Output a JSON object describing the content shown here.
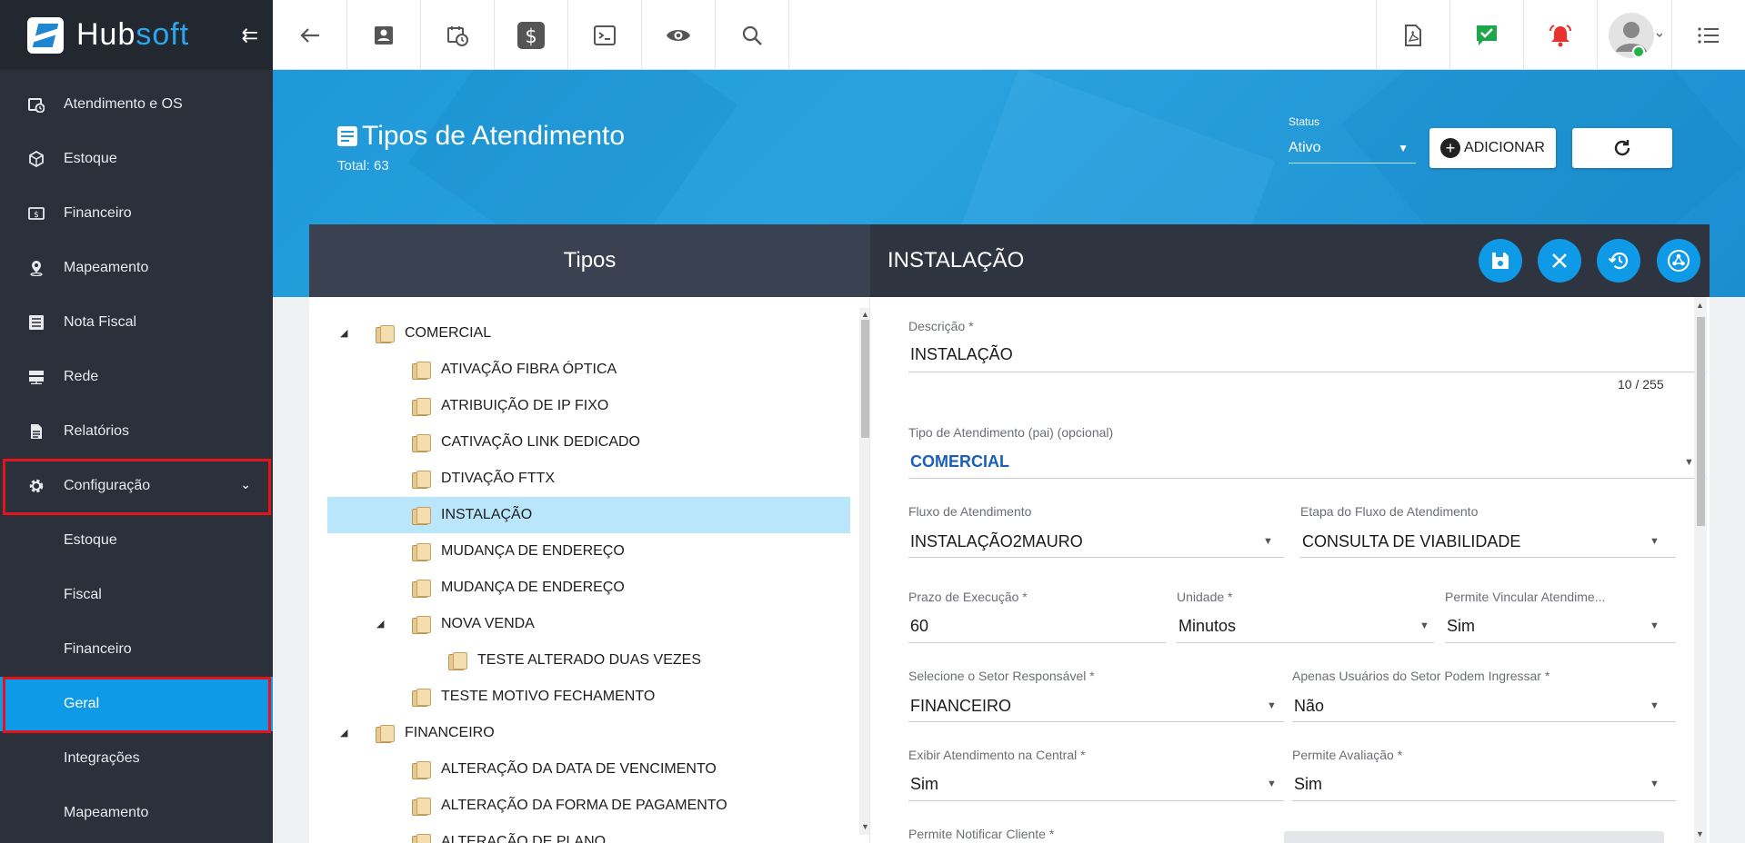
{
  "brand": {
    "name_part1": "Hub",
    "name_part2": "soft"
  },
  "sidebar": {
    "items": [
      {
        "label": "Atendimento e OS",
        "icon": "calendar-clock-icon"
      },
      {
        "label": "Estoque",
        "icon": "box-icon"
      },
      {
        "label": "Financeiro",
        "icon": "dollar-icon"
      },
      {
        "label": "Mapeamento",
        "icon": "map-pin-icon"
      },
      {
        "label": "Nota Fiscal",
        "icon": "list-icon"
      },
      {
        "label": "Rede",
        "icon": "server-icon"
      },
      {
        "label": "Relatórios",
        "icon": "document-icon"
      },
      {
        "label": "Configuração",
        "icon": "gear-icon"
      }
    ],
    "subitems": [
      {
        "label": "Estoque"
      },
      {
        "label": "Fiscal"
      },
      {
        "label": "Financeiro"
      },
      {
        "label": "Geral"
      },
      {
        "label": "Integrações"
      },
      {
        "label": "Mapeamento"
      }
    ]
  },
  "header": {
    "title": "Tipos de Atendimento",
    "total": "Total: 63",
    "status_label": "Status",
    "status_value": "Ativo",
    "add_label": "ADICIONAR"
  },
  "left_panel": {
    "title": "Tipos",
    "tree": [
      {
        "label": "COMERCIAL",
        "level": 0,
        "expanded": true
      },
      {
        "label": "ATIVAÇÃO FIBRA ÓPTICA",
        "level": 1
      },
      {
        "label": "ATRIBUIÇÃO DE IP FIXO",
        "level": 1
      },
      {
        "label": "CATIVAÇÃO LINK DEDICADO",
        "level": 1
      },
      {
        "label": "DTIVAÇÃO FTTX",
        "level": 1
      },
      {
        "label": "INSTALAÇÃO",
        "level": 1,
        "selected": true
      },
      {
        "label": "MUDANÇA DE ENDEREÇO",
        "level": 1
      },
      {
        "label": "MUDANÇA DE ENDEREÇO",
        "level": 1
      },
      {
        "label": "NOVA VENDA",
        "level": 1,
        "expanded": true
      },
      {
        "label": "TESTE ALTERADO DUAS VEZES",
        "level": 2
      },
      {
        "label": "TESTE MOTIVO FECHAMENTO",
        "level": 1
      },
      {
        "label": "FINANCEIRO",
        "level": 0,
        "expanded": true
      },
      {
        "label": "ALTERAÇÃO DA DATA DE VENCIMENTO",
        "level": 1
      },
      {
        "label": "ALTERAÇÃO DA FORMA DE PAGAMENTO",
        "level": 1
      },
      {
        "label": "ALTERAÇÃO DE PLANO",
        "level": 1
      }
    ]
  },
  "right_panel": {
    "title": "INSTALAÇÃO",
    "fields": {
      "descricao": {
        "label": "Descrição",
        "req": "*",
        "value": "INSTALAÇÃO",
        "counter": "10 / 255"
      },
      "tipo_pai": {
        "label": "Tipo de Atendimento (pai) (opcional)",
        "value": "COMERCIAL"
      },
      "fluxo": {
        "label": "Fluxo de Atendimento",
        "value": "INSTALAÇÃO2MAURO"
      },
      "etapa": {
        "label": "Etapa do Fluxo de Atendimento",
        "value": "CONSULTA DE VIABILIDADE"
      },
      "prazo": {
        "label": "Prazo de Execução",
        "req": "*",
        "value": "60"
      },
      "unidade": {
        "label": "Unidade",
        "req": "*",
        "value": "Minutos"
      },
      "vincular": {
        "label": "Permite Vincular Atendime...",
        "value": "Sim"
      },
      "setor": {
        "label": "Selecione o Setor Responsável",
        "req": "*",
        "value": "FINANCEIRO"
      },
      "apenas": {
        "label": "Apenas Usuários do Setor Podem Ingressar",
        "req": "*",
        "value": "Não"
      },
      "exibir": {
        "label": "Exibir Atendimento na Central",
        "req": "*",
        "value": "Sim"
      },
      "avaliacao": {
        "label": "Permite Avaliação",
        "req": "*",
        "value": "Sim"
      },
      "notificar": {
        "label": "Permite Notificar Cliente",
        "req": "*"
      }
    }
  },
  "colors": {
    "accent": "#0f9ae8",
    "sidebar_bg": "#2b303b",
    "highlight_border": "#e3151a",
    "header_band": "#1f98d8"
  }
}
